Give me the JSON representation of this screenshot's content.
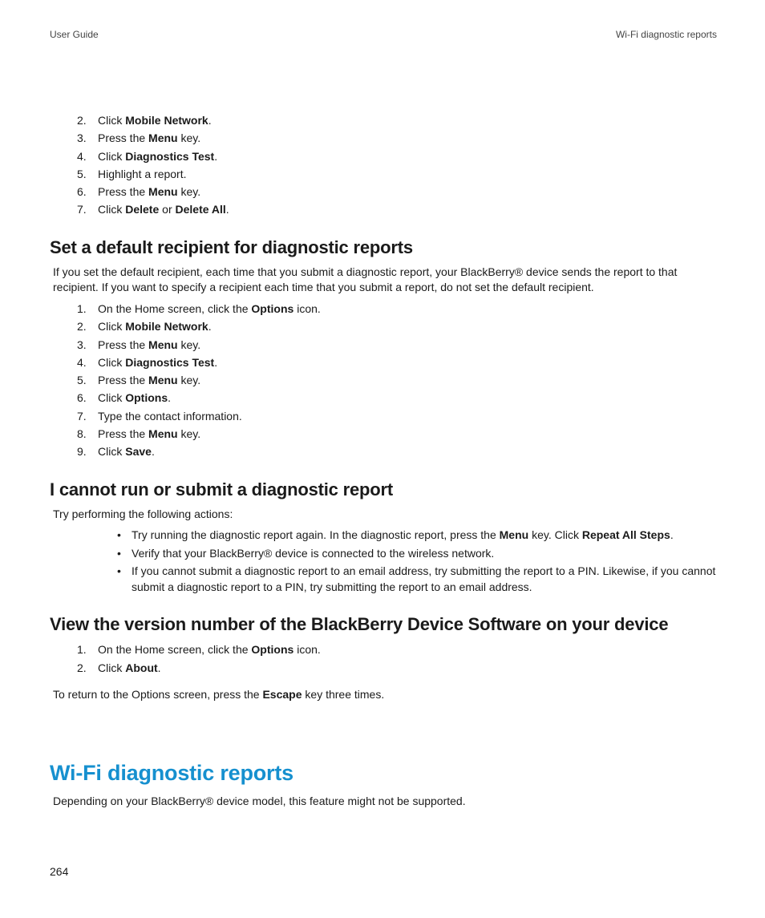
{
  "header": {
    "left": "User Guide",
    "right": "Wi-Fi diagnostic reports"
  },
  "topSteps": [
    {
      "bold1": "Mobile Network"
    },
    {
      "bold1": "Menu"
    },
    {
      "bold1": "Diagnostics Test"
    },
    {
      "text": "Highlight a report."
    },
    {
      "bold1": "Menu"
    },
    {
      "bold1": "Delete",
      "bold2": "Delete All"
    }
  ],
  "sections": [
    {
      "heading": "Set a default recipient for diagnostic reports",
      "intro": "If you set the default recipient, each time that you submit a diagnostic report, your BlackBerry® device sends the report to that recipient. If you want to specify a recipient each time that you submit a report, do not set the default recipient.",
      "steps": [
        {
          "bold1": "Options"
        },
        {
          "bold1": "Mobile Network"
        },
        {
          "bold1": "Menu"
        },
        {
          "bold1": "Diagnostics Test"
        },
        {
          "bold1": "Menu"
        },
        {
          "bold1": "Options"
        },
        {
          "text": "Type the contact information."
        },
        {
          "bold1": "Menu"
        },
        {
          "bold1": "Save"
        }
      ]
    },
    {
      "heading": "I cannot run or submit a diagnostic report",
      "intro": "Try performing the following actions:",
      "bullets": [
        {
          "bold1": "Menu",
          "bold2": "Repeat All Steps"
        },
        {
          "text": "Verify that your BlackBerry® device is connected to the wireless network."
        },
        {
          "text": "If you cannot submit a diagnostic report to an email address, try submitting the report to a PIN. Likewise, if you cannot submit a diagnostic report to a PIN, try submitting the report to an email address."
        }
      ]
    },
    {
      "heading": "View the version number of the BlackBerry Device Software on your device",
      "steps": [
        {
          "bold1": "Options"
        },
        {
          "bold1": "About"
        }
      ],
      "outroBold": "Escape"
    }
  ],
  "chapter": {
    "heading": "Wi-Fi diagnostic reports",
    "intro": "Depending on your BlackBerry® device model, this feature might not be supported."
  },
  "pageNumber": "264"
}
